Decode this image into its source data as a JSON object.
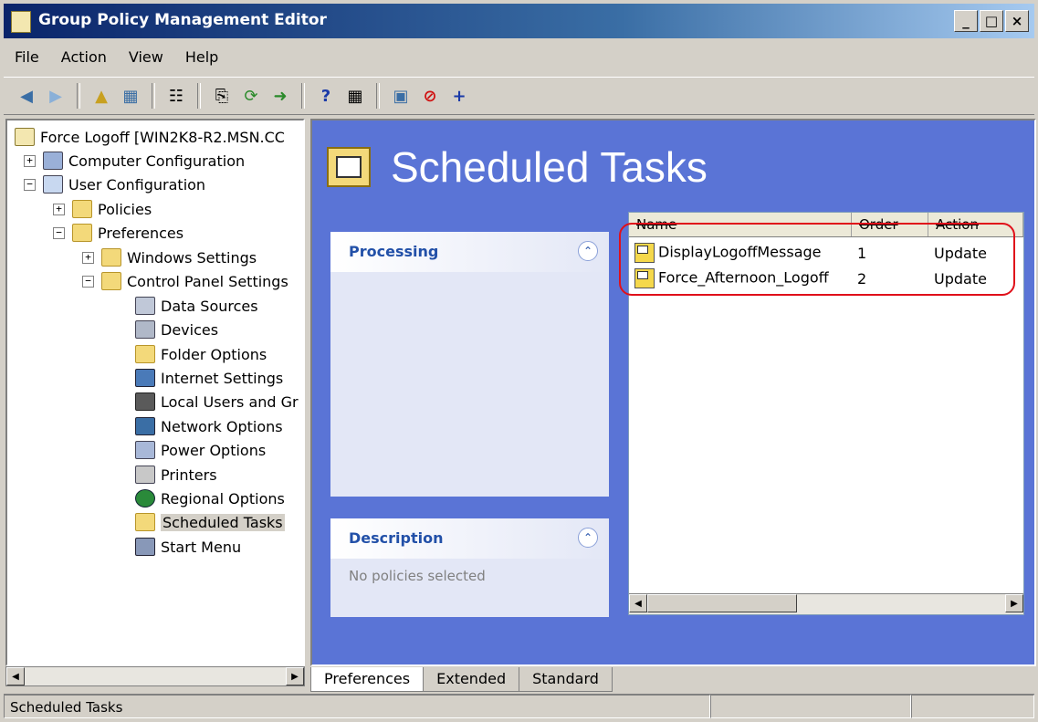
{
  "window": {
    "title": "Group Policy Management Editor",
    "min": "_",
    "max": "□",
    "close": "×"
  },
  "menu": [
    "File",
    "Action",
    "View",
    "Help"
  ],
  "tree": [
    {
      "label": "Force Logoff [WIN2K8-R2.MSN.CC",
      "icon": "policy-doc-icon",
      "indent": 0,
      "expander": ""
    },
    {
      "label": "Computer Configuration",
      "icon": "computer-icon",
      "indent": 1,
      "expander": "+"
    },
    {
      "label": "User Configuration",
      "icon": "users-icon",
      "indent": 1,
      "expander": "−"
    },
    {
      "label": "Policies",
      "icon": "folder-icon",
      "indent": 2,
      "expander": "+"
    },
    {
      "label": "Preferences",
      "icon": "folder-icon",
      "indent": 2,
      "expander": "−"
    },
    {
      "label": "Windows Settings",
      "icon": "folder-icon",
      "indent": 3,
      "expander": "+"
    },
    {
      "label": "Control Panel Settings",
      "icon": "control-panel-icon",
      "indent": 3,
      "expander": "−"
    },
    {
      "label": "Data Sources",
      "icon": "data-sources-icon",
      "indent": 4,
      "expander": ""
    },
    {
      "label": "Devices",
      "icon": "devices-icon",
      "indent": 4,
      "expander": ""
    },
    {
      "label": "Folder Options",
      "icon": "folder-options-icon",
      "indent": 4,
      "expander": ""
    },
    {
      "label": "Internet Settings",
      "icon": "internet-settings-icon",
      "indent": 4,
      "expander": ""
    },
    {
      "label": "Local Users and Gr",
      "icon": "local-users-icon",
      "indent": 4,
      "expander": ""
    },
    {
      "label": "Network Options",
      "icon": "network-options-icon",
      "indent": 4,
      "expander": ""
    },
    {
      "label": "Power Options",
      "icon": "power-options-icon",
      "indent": 4,
      "expander": ""
    },
    {
      "label": "Printers",
      "icon": "printers-icon",
      "indent": 4,
      "expander": ""
    },
    {
      "label": "Regional Options",
      "icon": "regional-options-icon",
      "indent": 4,
      "expander": ""
    },
    {
      "label": "Scheduled Tasks",
      "icon": "scheduled-tasks-icon",
      "indent": 4,
      "expander": "",
      "selected": true
    },
    {
      "label": "Start Menu",
      "icon": "start-menu-icon",
      "indent": 4,
      "expander": ""
    }
  ],
  "main": {
    "title": "Scheduled Tasks",
    "processing": {
      "heading": "Processing"
    },
    "description": {
      "heading": "Description",
      "text": "No policies selected"
    },
    "columns": [
      "Name",
      "Order",
      "Action"
    ],
    "rows": [
      {
        "name": "DisplayLogoffMessage",
        "order": "1",
        "action": "Update"
      },
      {
        "name": "Force_Afternoon_Logoff",
        "order": "2",
        "action": "Update"
      }
    ]
  },
  "tabs": [
    "Preferences",
    "Extended",
    "Standard"
  ],
  "status": {
    "text": "Scheduled Tasks"
  },
  "colors": {
    "accent_blue": "#5a74d6",
    "highlight": "#e0101a",
    "title_bar": "#0a246a"
  }
}
